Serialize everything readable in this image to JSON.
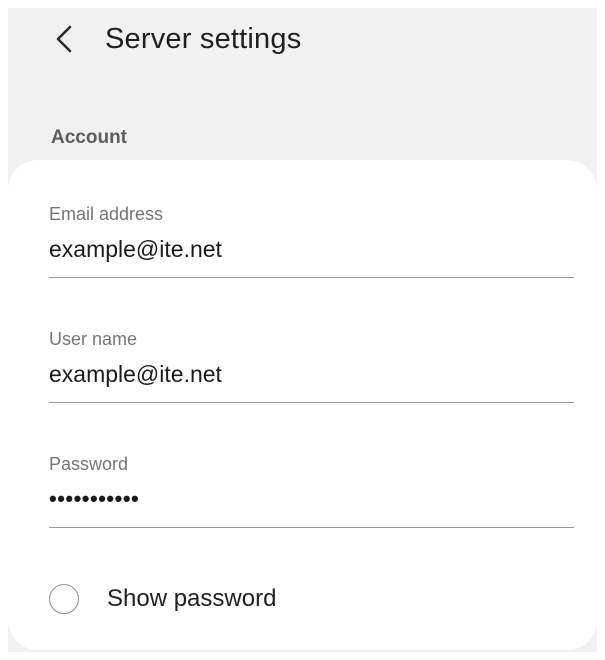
{
  "header": {
    "back_icon": "chevron-left-icon",
    "title": "Server settings"
  },
  "section": {
    "label": "Account"
  },
  "fields": {
    "email": {
      "label": "Email address",
      "value": "example@ite.net"
    },
    "username": {
      "label": "User name",
      "value": "example@ite.net"
    },
    "password": {
      "label": "Password",
      "masked_value": "•••••••••••"
    }
  },
  "show_password": {
    "label": "Show password",
    "checked": false
  },
  "colors": {
    "background": "#f1f1f1",
    "card": "#ffffff",
    "text_primary": "#1f1f1f",
    "text_secondary": "#757575",
    "section_label": "#5e5e5e",
    "divider": "#9a9a9a"
  }
}
